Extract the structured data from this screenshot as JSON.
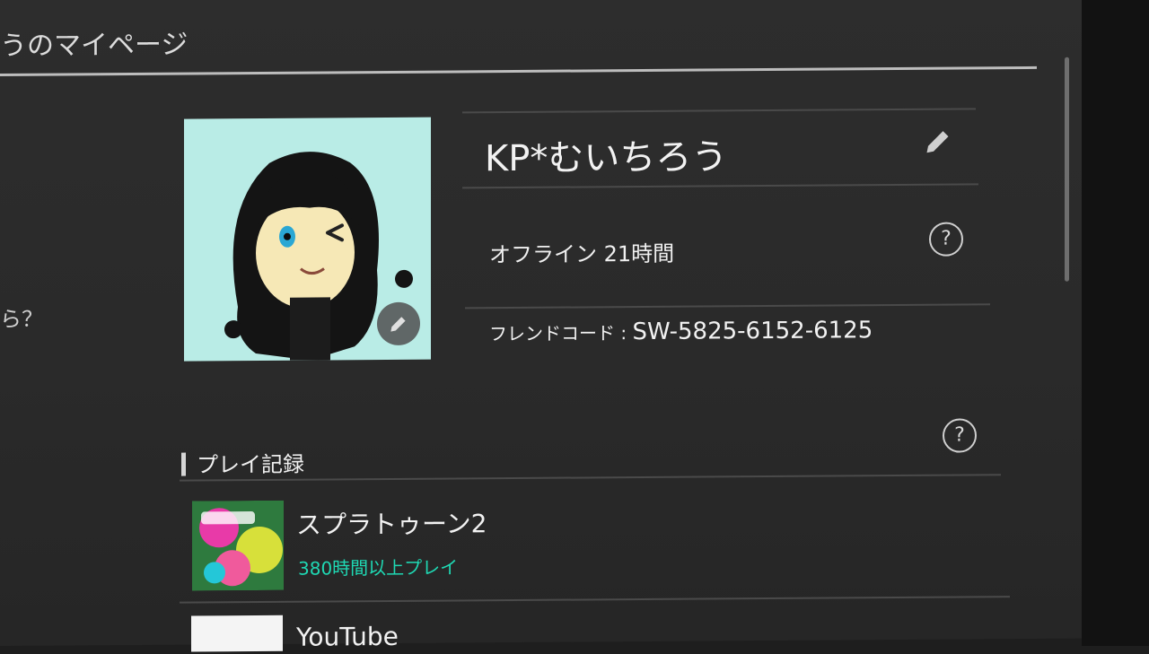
{
  "page": {
    "title": "うのマイページ",
    "side_text": "ら？"
  },
  "profile": {
    "username": "KP*むいちろう",
    "status": "オフライン 21時間",
    "friend_code_label": "フレンドコード : ",
    "friend_code": "SW-5825-6152-6125",
    "help_glyph": "?"
  },
  "play_record": {
    "heading": "プレイ記録",
    "help_glyph": "?",
    "games": [
      {
        "title": "スプラトゥーン2",
        "playtime": "380時間以上プレイ",
        "icon": "splatoon-2-icon"
      },
      {
        "title": "YouTube",
        "playtime": "",
        "icon": "youtube-icon"
      }
    ]
  },
  "colors": {
    "background": "#2c2c2c",
    "accent_playtime": "#1fd9b4",
    "avatar_bg": "#b9ece6"
  },
  "icons": [
    "pencil-edit-icon",
    "help-question-icon"
  ]
}
